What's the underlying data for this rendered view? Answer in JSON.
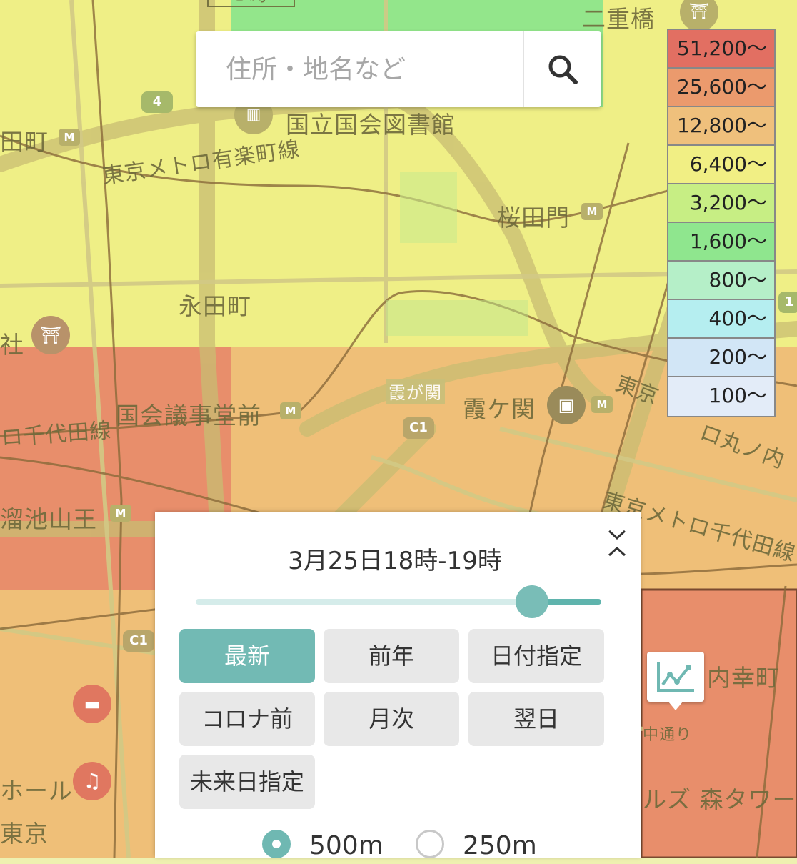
{
  "search": {
    "placeholder": "住所・地名など",
    "icon": "search-icon"
  },
  "legend": [
    {
      "label": "51,200〜",
      "color": "#e26f62"
    },
    {
      "label": "25,600〜",
      "color": "#eb9a6d"
    },
    {
      "label": "12,800〜",
      "color": "#efc07c"
    },
    {
      "label": "6,400〜",
      "color": "#f1ef84"
    },
    {
      "label": "3,200〜",
      "color": "#c7ee84"
    },
    {
      "label": "1,600〜",
      "color": "#8fe68e"
    },
    {
      "label": "800〜",
      "color": "#b5efc8"
    },
    {
      "label": "400〜",
      "color": "#b5eef0"
    },
    {
      "label": "200〜",
      "color": "#d2e6f6"
    },
    {
      "label": "100〜",
      "color": "#e3ecf8"
    }
  ],
  "map": {
    "labels": {
      "sanchome_jct": "三宅坂JCT",
      "nijubashi": "二重橋",
      "national_diet_library": "国立国会図書館",
      "nagatacho_station": "田町",
      "yurakucho_line": "東京メトロ有楽町線",
      "sakuradamon": "桜田門",
      "nagatacho": "永田町",
      "shrine": "社",
      "kokkai_gijidomae": "国会議事堂前",
      "chiyoda_line_left": "ロ千代田線",
      "kasumigaseki_road": "霞が関",
      "kasumigaseki_station": "霞ケ関",
      "tokyo_right": "東京",
      "marunouchi_line": "ロ丸ノ内",
      "tameike_sanno": "溜池山王",
      "chiyoda_line_right": "東京メトロ千代田線",
      "uchisaiwaicho": "内幸町",
      "hibiya_street": "中通り",
      "mori_tower": "ルズ 森タワー",
      "hall": "ホール",
      "tokyo_bottom": "東京"
    },
    "route_shields": {
      "r4": "4",
      "c1_center": "C1",
      "c1_left": "C1",
      "r1": "1"
    }
  },
  "panel": {
    "title": "3月25日18時-19時",
    "slider_value": 0.83,
    "buttons": [
      {
        "label": "最新",
        "active": true
      },
      {
        "label": "前年",
        "active": false
      },
      {
        "label": "日付指定",
        "active": false
      },
      {
        "label": "コロナ前",
        "active": false
      },
      {
        "label": "月次",
        "active": false
      },
      {
        "label": "翌日",
        "active": false
      },
      {
        "label": "未来日指定",
        "active": false
      }
    ],
    "mesh_options": [
      {
        "label": "500m",
        "selected": true
      },
      {
        "label": "250m",
        "selected": false
      }
    ]
  },
  "icons": {
    "graph": "line-chart-icon",
    "collapse": "collapse-toggle-icon"
  }
}
